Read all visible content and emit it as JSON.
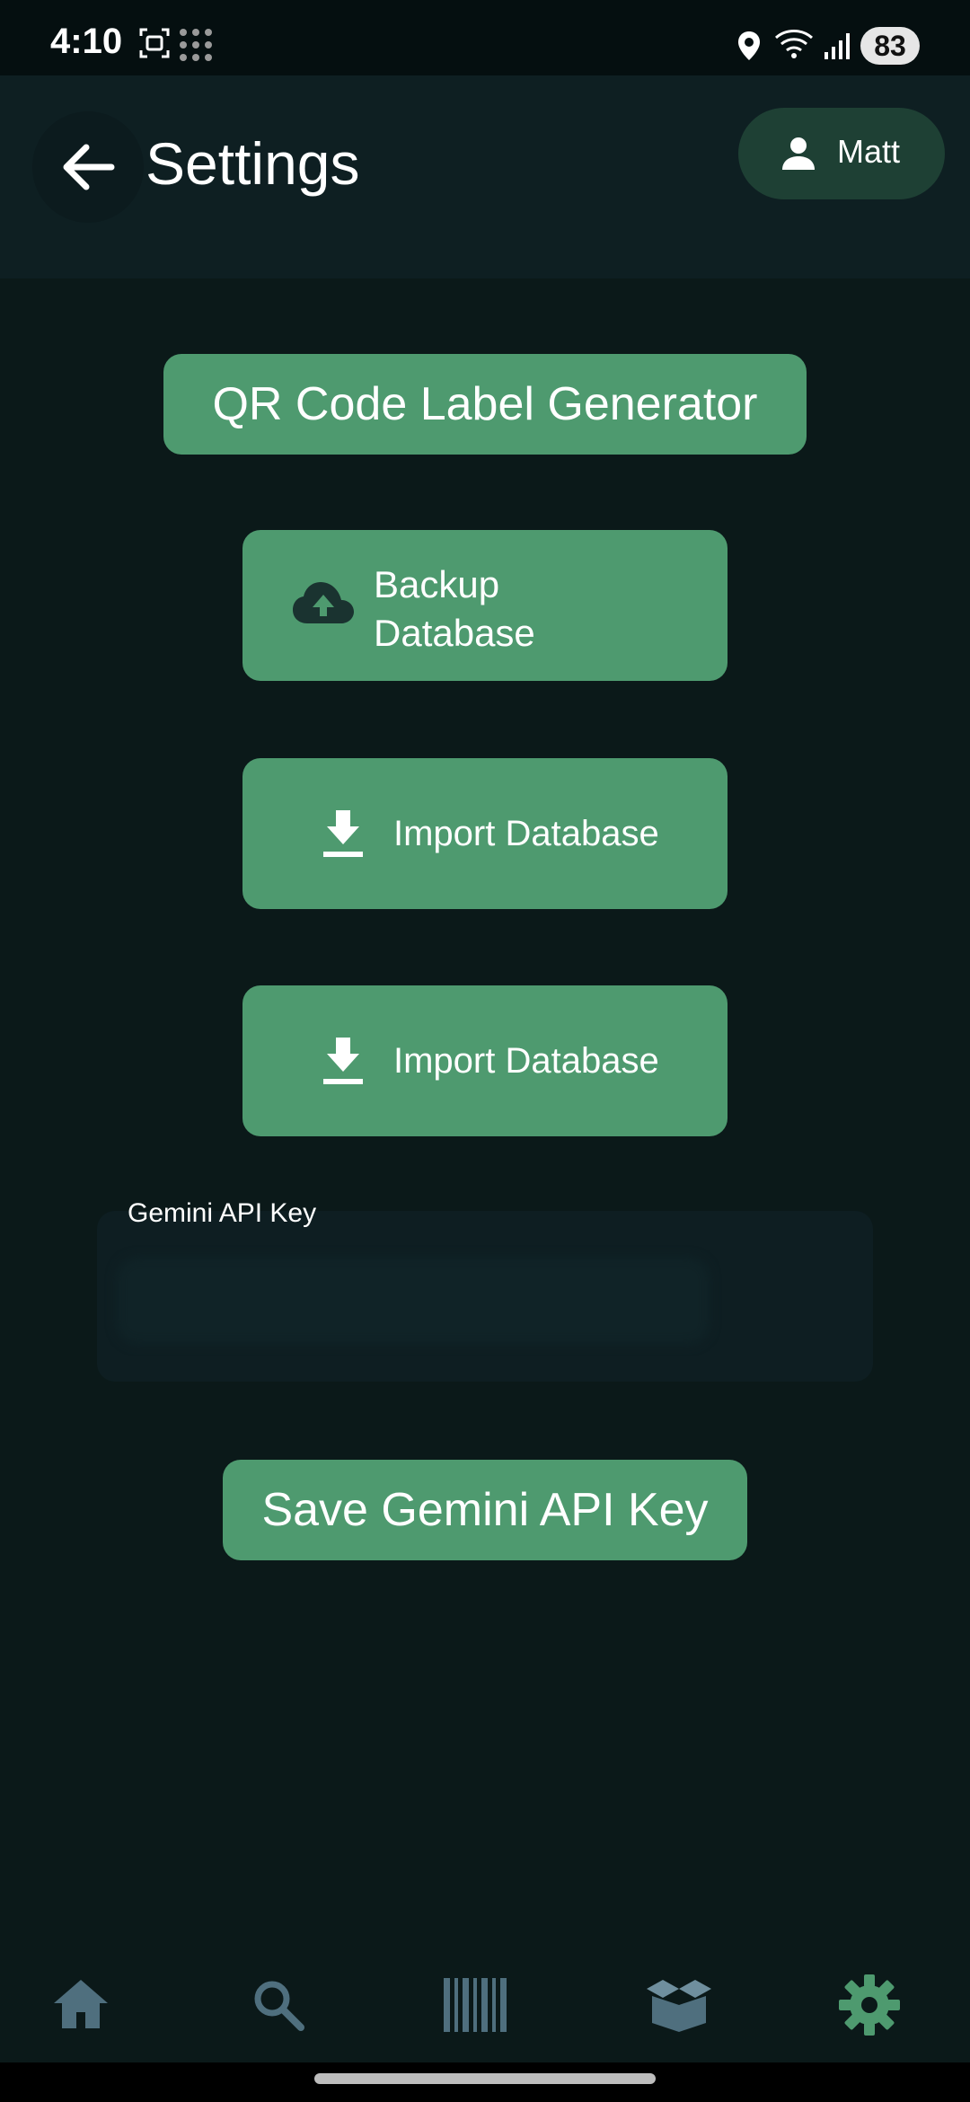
{
  "status_bar": {
    "time": "4:10",
    "battery": "83",
    "icons": [
      "screenshot-icon",
      "dots-grid-icon",
      "location-icon",
      "wifi-icon",
      "signal-icon"
    ]
  },
  "app_bar": {
    "title": "Settings",
    "back_icon": "arrow-left-icon",
    "user": {
      "name": "Matt",
      "icon": "person-icon"
    }
  },
  "actions": {
    "qr_label": "QR Code Label Generator",
    "backup_label": "Backup Database",
    "backup_icon": "cloud-upload-icon",
    "import_label_1": "Import Database",
    "import_label_2": "Import Database",
    "import_icon": "download-icon"
  },
  "api_key": {
    "label": "Gemini API Key",
    "value": ""
  },
  "save_label": "Save Gemini API Key",
  "bottom_nav": [
    {
      "name": "home",
      "icon": "home-icon"
    },
    {
      "name": "search",
      "icon": "search-icon"
    },
    {
      "name": "barcode",
      "icon": "barcode-icon"
    },
    {
      "name": "box",
      "icon": "box-icon"
    },
    {
      "name": "settings",
      "icon": "gear-icon",
      "active": true
    }
  ],
  "colors": {
    "background": "#0b1919",
    "app_bar": "#0e1f22",
    "button": "#4e9a6f",
    "user_chip": "#1e4034",
    "nav_icon": "#4f6f7e",
    "nav_active": "#4e9a6f"
  }
}
